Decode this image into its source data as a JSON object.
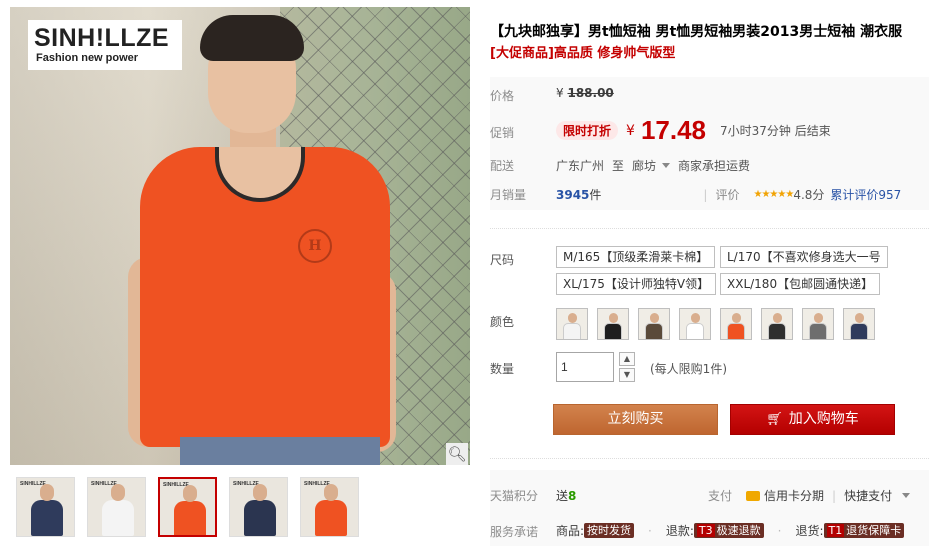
{
  "gallery": {
    "brand_name": "SINH!LLZE",
    "brand_tagline": "Fashion new power",
    "zoom_icon": "magnifier-icon",
    "thumbnails": [
      {
        "shirt_color": "#2f3b5c",
        "logo": "SINHILLZE",
        "active": false
      },
      {
        "shirt_color": "#f4f4f4",
        "logo": "SINHILLZE",
        "active": false
      },
      {
        "shirt_color": "#ef5222",
        "logo": "SINHILLZE",
        "active": true
      },
      {
        "shirt_color": "#2b3550",
        "logo": "SINHILLZE",
        "active": false
      },
      {
        "shirt_color": "#ef5222",
        "logo": "SINHILLZE",
        "active": false
      }
    ]
  },
  "product": {
    "title": "【九块邮独享】男t恤短袖 男t恤男短袖男装2013男士短袖 潮衣服",
    "subtitle": "[大促商品]高品质 修身帅气版型"
  },
  "price": {
    "label": "价格",
    "currency": "¥",
    "original": "188.00",
    "promo_label": "促销",
    "promo_tag": "限时打折",
    "current": "17.48",
    "countdown": "7小时37分钟 后结束"
  },
  "shipping": {
    "label": "配送",
    "from": "广东广州",
    "to_word": "至",
    "destination": "廊坊",
    "note": "商家承担运费"
  },
  "sales": {
    "label": "月销量",
    "count": "3945",
    "unit": "件",
    "rating_label": "评价",
    "stars": "★★★★★",
    "score": "4.8分",
    "review_link": "累计评价957"
  },
  "options": {
    "size_label": "尺码",
    "sizes": [
      "M/165【顶级柔滑莱卡棉】",
      "L/170【不喜欢修身选大一号",
      "XL/175【设计师独特V领】",
      "XXL/180【包邮圆通快递】"
    ],
    "color_label": "颜色",
    "colors": [
      "#f4f4f4",
      "#1e1e1e",
      "#5a4a3a",
      "#ffffff",
      "#ef5222",
      "#2f2f2f",
      "#6e6e6e",
      "#2f3b5c"
    ]
  },
  "quantity": {
    "label": "数量",
    "value": "1",
    "limit": "(每人限购1件)"
  },
  "actions": {
    "buy_now": "立刻购买",
    "add_cart": "加入购物车"
  },
  "bottom": {
    "points_label": "天猫积分",
    "points_prefix": "送",
    "points_value": "8",
    "pay_label": "支付",
    "pay_card": "信用卡分期",
    "pay_fast": "快捷支付",
    "service_label": "服务承诺",
    "service_goods": "商品:",
    "service_goods_badge": "按时发货",
    "service_refund": "退款:",
    "service_refund_key": "T3",
    "service_refund_badge": "极速退款",
    "service_return": "退货:",
    "service_return_key": "T1",
    "service_return_badge": "退货保障卡"
  },
  "colors": {
    "accent": "#c40000",
    "buy_button": "#c8703a",
    "cart_button": "#c40000"
  }
}
